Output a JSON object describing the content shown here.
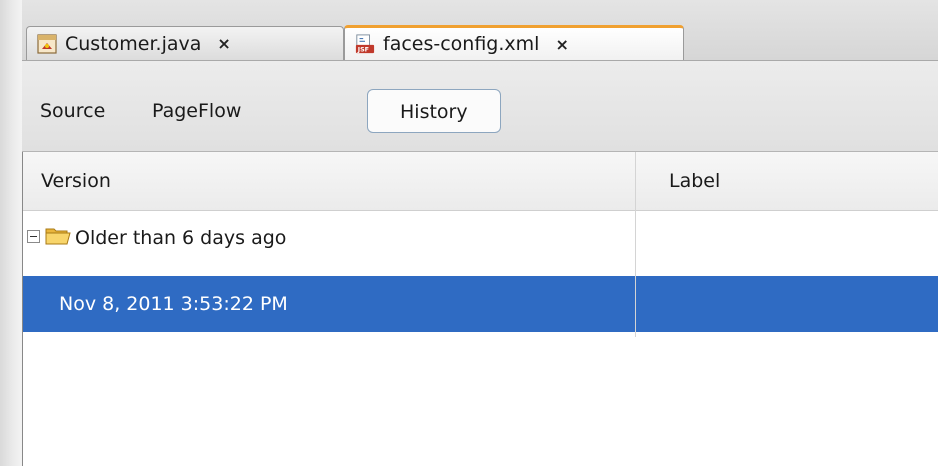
{
  "editor_tabs": [
    {
      "label": "Customer.java",
      "close": "×",
      "icon": "java-file-icon",
      "active": false
    },
    {
      "label": "faces-config.xml",
      "close": "×",
      "icon": "jsf-file-icon",
      "active": true
    }
  ],
  "view_tabs": {
    "source": "Source",
    "pageflow": "PageFlow",
    "history": "History",
    "active": "History"
  },
  "table": {
    "columns": [
      "Version",
      "Label"
    ],
    "group": {
      "label": "Older than 6 days ago",
      "expanded": true
    },
    "rows": [
      {
        "version": "Nov 8, 2011 3:53:22 PM",
        "label": "",
        "selected": true
      }
    ]
  },
  "colors": {
    "selection": "#2f6bc3",
    "active_tab_accent": "#f0a030"
  }
}
